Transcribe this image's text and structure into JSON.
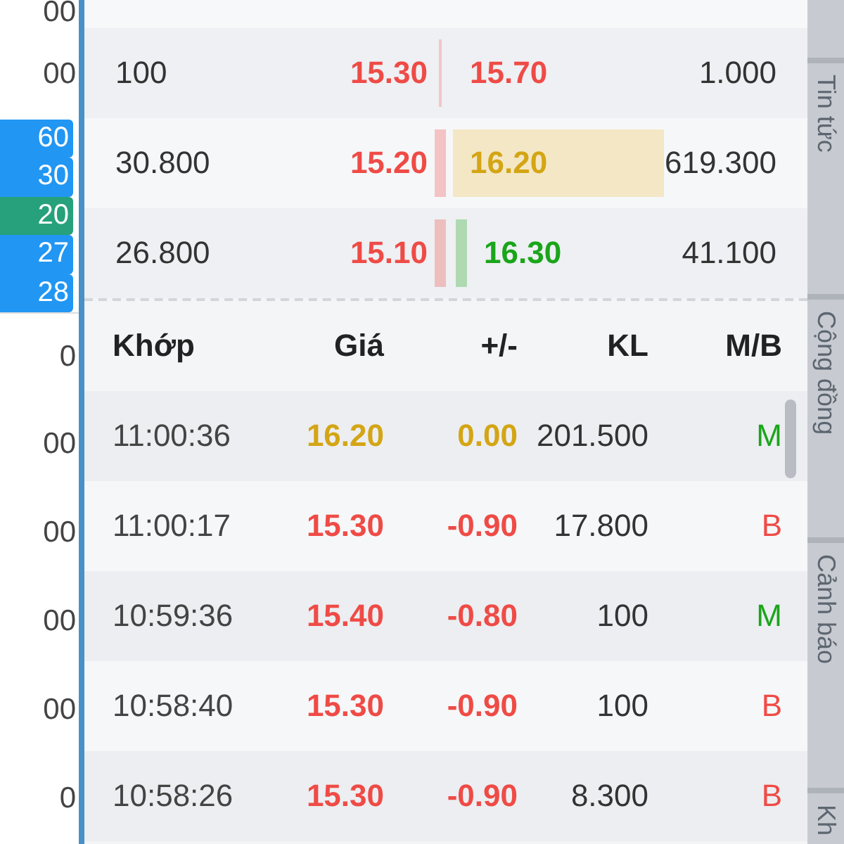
{
  "left_column": [
    {
      "kind": "value",
      "text": "00"
    },
    {
      "kind": "value",
      "text": "00"
    },
    {
      "kind": "badge",
      "text": "60",
      "color": "#2196f3"
    },
    {
      "kind": "badge",
      "text": "30",
      "color": "#2196f3"
    },
    {
      "kind": "badge",
      "text": "20",
      "color": "#26a17b"
    },
    {
      "kind": "badge",
      "text": "27",
      "color": "#2196f3"
    },
    {
      "kind": "badge",
      "text": "28",
      "color": "#2196f3"
    },
    {
      "kind": "value",
      "text": "0"
    },
    {
      "kind": "value",
      "text": "00"
    },
    {
      "kind": "value",
      "text": "00"
    },
    {
      "kind": "value",
      "text": "00"
    },
    {
      "kind": "value",
      "text": "00"
    },
    {
      "kind": "value",
      "text": "0"
    }
  ],
  "order_book": [
    {
      "bid": {
        "volume": "100",
        "price": "15.30",
        "color": "#ef4b46",
        "bar": false
      },
      "ask": {
        "price": "15.70",
        "color": "#ef4b46",
        "bar": false,
        "highlighted": false,
        "volume": "1.000"
      }
    },
    {
      "bid": {
        "volume": "30.800",
        "price": "15.20",
        "color": "#ef4b46",
        "bar": true
      },
      "ask": {
        "price": "16.20",
        "color": "#d4a514",
        "bar": false,
        "highlighted": true,
        "volume": "619.300"
      }
    },
    {
      "bid": {
        "volume": "26.800",
        "price": "15.10",
        "color": "#ef4b46",
        "bar": true
      },
      "ask": {
        "price": "16.30",
        "color": "#1aa51a",
        "bar": true,
        "highlighted": false,
        "volume": "41.100"
      }
    }
  ],
  "trades": {
    "columns": [
      "Khớp",
      "Giá",
      "+/-",
      "KL",
      "M/B"
    ],
    "rows": [
      {
        "time": "11:00:36",
        "price": "16.20",
        "change": "0.00",
        "color": "#d4a514",
        "volume": "201.500",
        "side": {
          "text": "M",
          "color": "#1aa51a"
        }
      },
      {
        "time": "11:00:17",
        "price": "15.30",
        "change": "-0.90",
        "color": "#ef4b46",
        "volume": "17.800",
        "side": {
          "text": "B",
          "color": "#ef4b46"
        }
      },
      {
        "time": "10:59:36",
        "price": "15.40",
        "change": "-0.80",
        "color": "#ef4b46",
        "volume": "100",
        "side": {
          "text": "M",
          "color": "#1aa51a"
        }
      },
      {
        "time": "10:58:40",
        "price": "15.30",
        "change": "-0.90",
        "color": "#ef4b46",
        "volume": "100",
        "side": {
          "text": "B",
          "color": "#ef4b46"
        }
      },
      {
        "time": "10:58:26",
        "price": "15.30",
        "change": "-0.90",
        "color": "#ef4b46",
        "volume": "8.300",
        "side": {
          "text": "B",
          "color": "#ef4b46"
        }
      }
    ]
  },
  "side_tabs": [
    "Tin tức",
    "Cộng đồng",
    "Cảnh báo",
    "Kh"
  ]
}
